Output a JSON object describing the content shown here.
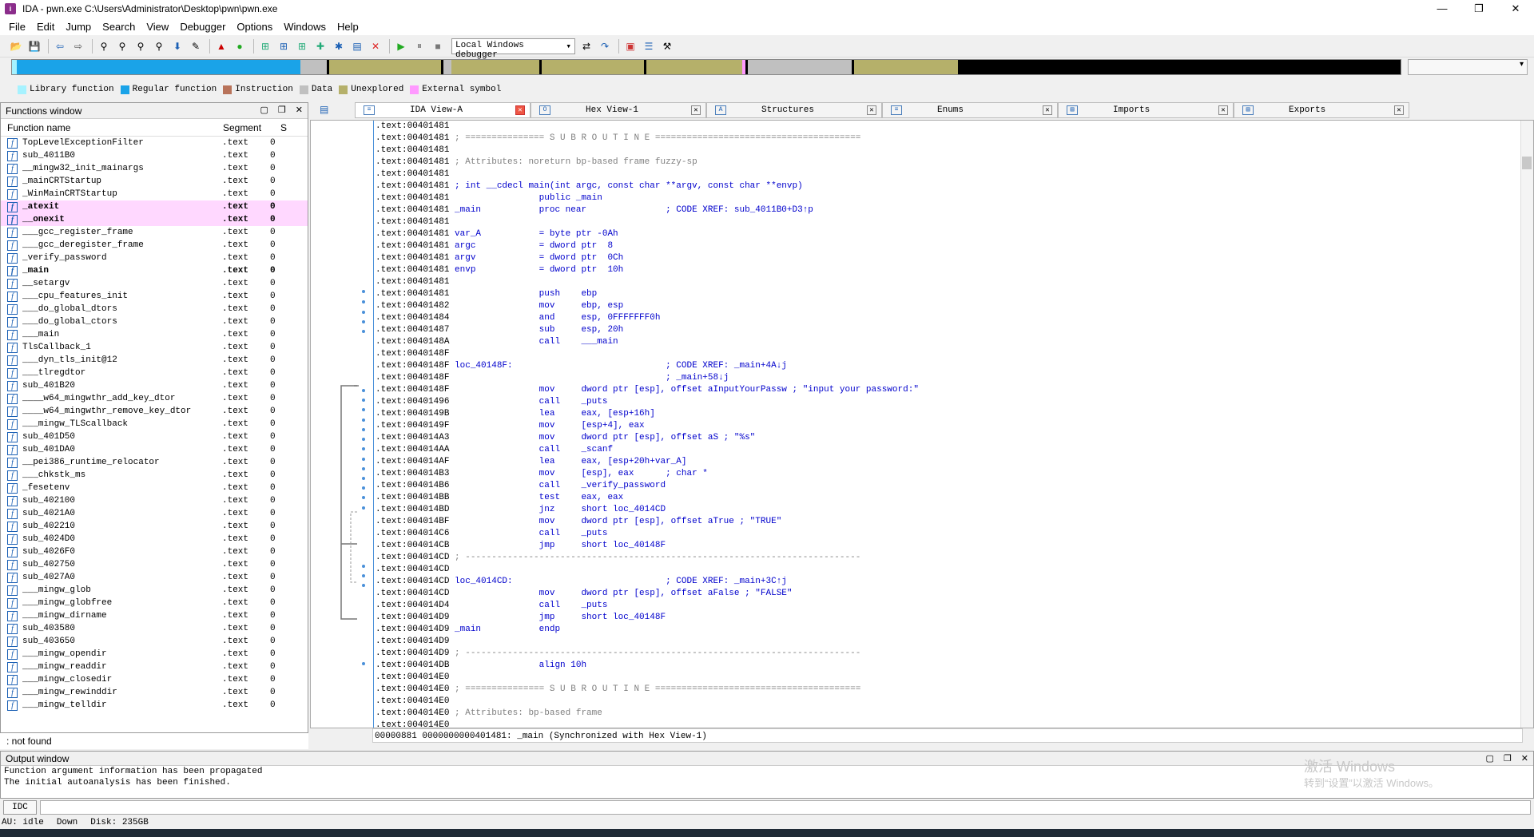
{
  "window": {
    "title": "IDA - pwn.exe C:\\Users\\Administrator\\Desktop\\pwn\\pwn.exe",
    "min": "—",
    "max": "❐",
    "close": "✕"
  },
  "menu": [
    "File",
    "Edit",
    "Jump",
    "Search",
    "View",
    "Debugger",
    "Options",
    "Windows",
    "Help"
  ],
  "toolbar": {
    "debugger": "Local Windows debugger"
  },
  "legend": [
    {
      "label": "Library function",
      "color": "#a6f2ff"
    },
    {
      "label": "Regular function",
      "color": "#1aa3e8"
    },
    {
      "label": "Instruction",
      "color": "#b8735a"
    },
    {
      "label": "Data",
      "color": "#c0c0c0"
    },
    {
      "label": "Unexplored",
      "color": "#b5b06a"
    },
    {
      "label": "External symbol",
      "color": "#ff99ff"
    }
  ],
  "functions_window": {
    "title": "Functions window",
    "col_name": "Function name",
    "col_segment": "Segment",
    "col_extra": "S",
    "rows": [
      {
        "name": "TopLevelExceptionFilter",
        "seg": ".text",
        "x": "0"
      },
      {
        "name": "sub_4011B0",
        "seg": ".text",
        "x": "0"
      },
      {
        "name": "__mingw32_init_mainargs",
        "seg": ".text",
        "x": "0"
      },
      {
        "name": "_mainCRTStartup",
        "seg": ".text",
        "x": "0"
      },
      {
        "name": "_WinMainCRTStartup",
        "seg": ".text",
        "x": "0"
      },
      {
        "name": "_atexit",
        "seg": ".text",
        "x": "0",
        "style": "pink"
      },
      {
        "name": "__onexit",
        "seg": ".text",
        "x": "0",
        "style": "pink"
      },
      {
        "name": "___gcc_register_frame",
        "seg": ".text",
        "x": "0"
      },
      {
        "name": "___gcc_deregister_frame",
        "seg": ".text",
        "x": "0"
      },
      {
        "name": "_verify_password",
        "seg": ".text",
        "x": "0"
      },
      {
        "name": "_main",
        "seg": ".text",
        "x": "0",
        "style": "bold"
      },
      {
        "name": "__setargv",
        "seg": ".text",
        "x": "0"
      },
      {
        "name": "___cpu_features_init",
        "seg": ".text",
        "x": "0"
      },
      {
        "name": "___do_global_dtors",
        "seg": ".text",
        "x": "0"
      },
      {
        "name": "___do_global_ctors",
        "seg": ".text",
        "x": "0"
      },
      {
        "name": "___main",
        "seg": ".text",
        "x": "0"
      },
      {
        "name": "TlsCallback_1",
        "seg": ".text",
        "x": "0"
      },
      {
        "name": "___dyn_tls_init@12",
        "seg": ".text",
        "x": "0"
      },
      {
        "name": "___tlregdtor",
        "seg": ".text",
        "x": "0"
      },
      {
        "name": "sub_401B20",
        "seg": ".text",
        "x": "0"
      },
      {
        "name": "____w64_mingwthr_add_key_dtor",
        "seg": ".text",
        "x": "0"
      },
      {
        "name": "____w64_mingwthr_remove_key_dtor",
        "seg": ".text",
        "x": "0"
      },
      {
        "name": "___mingw_TLScallback",
        "seg": ".text",
        "x": "0"
      },
      {
        "name": "sub_401D50",
        "seg": ".text",
        "x": "0"
      },
      {
        "name": "sub_401DA0",
        "seg": ".text",
        "x": "0"
      },
      {
        "name": "__pei386_runtime_relocator",
        "seg": ".text",
        "x": "0"
      },
      {
        "name": "___chkstk_ms",
        "seg": ".text",
        "x": "0"
      },
      {
        "name": "_fesetenv",
        "seg": ".text",
        "x": "0"
      },
      {
        "name": "sub_402100",
        "seg": ".text",
        "x": "0"
      },
      {
        "name": "sub_4021A0",
        "seg": ".text",
        "x": "0"
      },
      {
        "name": "sub_402210",
        "seg": ".text",
        "x": "0"
      },
      {
        "name": "sub_4024D0",
        "seg": ".text",
        "x": "0"
      },
      {
        "name": "sub_4026F0",
        "seg": ".text",
        "x": "0"
      },
      {
        "name": "sub_402750",
        "seg": ".text",
        "x": "0"
      },
      {
        "name": "sub_4027A0",
        "seg": ".text",
        "x": "0"
      },
      {
        "name": "___mingw_glob",
        "seg": ".text",
        "x": "0"
      },
      {
        "name": "___mingw_globfree",
        "seg": ".text",
        "x": "0"
      },
      {
        "name": "___mingw_dirname",
        "seg": ".text",
        "x": "0"
      },
      {
        "name": "sub_403580",
        "seg": ".text",
        "x": "0"
      },
      {
        "name": "sub_403650",
        "seg": ".text",
        "x": "0"
      },
      {
        "name": "___mingw_opendir",
        "seg": ".text",
        "x": "0"
      },
      {
        "name": "___mingw_readdir",
        "seg": ".text",
        "x": "0"
      },
      {
        "name": "___mingw_closedir",
        "seg": ".text",
        "x": "0"
      },
      {
        "name": "___mingw_rewinddir",
        "seg": ".text",
        "x": "0"
      },
      {
        "name": "___mingw_telldir",
        "seg": ".text",
        "x": "0"
      }
    ],
    "status": ": not found"
  },
  "tabs": [
    {
      "label": "IDA View-A",
      "active": true
    },
    {
      "label": "Hex View-1"
    },
    {
      "label": "Structures"
    },
    {
      "label": "Enums"
    },
    {
      "label": "Imports"
    },
    {
      "label": "Exports"
    }
  ],
  "code_lines": [
    {
      "a": ".text:00401481",
      "t": ""
    },
    {
      "a": ".text:00401481",
      "t": " ; =============== S U B R O U T I N E =======================================",
      "c": "cm"
    },
    {
      "a": ".text:00401481",
      "t": ""
    },
    {
      "a": ".text:00401481",
      "t": " ; Attributes: noreturn bp-based frame fuzzy-sp",
      "c": "cm"
    },
    {
      "a": ".text:00401481",
      "t": ""
    },
    {
      "a": ".text:00401481",
      "t": " ; int __cdecl main(int argc, const char **argv, const char **envp)",
      "c": "blue"
    },
    {
      "a": ".text:00401481",
      "t": "                 public _main",
      "c": "blue"
    },
    {
      "a": ".text:00401481",
      "t": " _main           proc near               ; CODE XREF: sub_4011B0+D3↑p",
      "c": "blue"
    },
    {
      "a": ".text:00401481",
      "t": ""
    },
    {
      "a": ".text:00401481",
      "t": " var_A           = byte ptr -0Ah",
      "c": "blue"
    },
    {
      "a": ".text:00401481",
      "t": " argc            = dword ptr  8",
      "c": "blue"
    },
    {
      "a": ".text:00401481",
      "t": " argv            = dword ptr  0Ch",
      "c": "blue"
    },
    {
      "a": ".text:00401481",
      "t": " envp            = dword ptr  10h",
      "c": "blue"
    },
    {
      "a": ".text:00401481",
      "t": "",
      "c": "blue"
    },
    {
      "a": ".text:00401481",
      "t": "                 push    ebp",
      "c": "blue"
    },
    {
      "a": ".text:00401482",
      "t": "                 mov     ebp, esp",
      "c": "blue"
    },
    {
      "a": ".text:00401484",
      "t": "                 and     esp, 0FFFFFFF0h",
      "c": "blue"
    },
    {
      "a": ".text:00401487",
      "t": "                 sub     esp, 20h",
      "c": "blue"
    },
    {
      "a": ".text:0040148A",
      "t": "                 call    ___main",
      "c": "blue"
    },
    {
      "a": ".text:0040148F",
      "t": ""
    },
    {
      "a": ".text:0040148F",
      "t": " loc_40148F:                             ; CODE XREF: _main+4A↓j",
      "c": "blue"
    },
    {
      "a": ".text:0040148F",
      "t": "                                         ; _main+58↓j",
      "c": "blue"
    },
    {
      "a": ".text:0040148F",
      "t": "                 mov     dword ptr [esp], offset aInputYourPassw ; \"input your password:\"",
      "c": "blue"
    },
    {
      "a": ".text:00401496",
      "t": "                 call    _puts",
      "c": "blue"
    },
    {
      "a": ".text:0040149B",
      "t": "                 lea     eax, [esp+16h]",
      "c": "blue"
    },
    {
      "a": ".text:0040149F",
      "t": "                 mov     [esp+4], eax",
      "c": "blue"
    },
    {
      "a": ".text:004014A3",
      "t": "                 mov     dword ptr [esp], offset aS ; \"%s\"",
      "c": "blue"
    },
    {
      "a": ".text:004014AA",
      "t": "                 call    _scanf",
      "c": "blue"
    },
    {
      "a": ".text:004014AF",
      "t": "                 lea     eax, [esp+20h+var_A]",
      "c": "blue"
    },
    {
      "a": ".text:004014B3",
      "t": "                 mov     [esp], eax      ; char *",
      "c": "blue"
    },
    {
      "a": ".text:004014B6",
      "t": "                 call    _verify_password",
      "c": "blue"
    },
    {
      "a": ".text:004014BB",
      "t": "                 test    eax, eax",
      "c": "blue"
    },
    {
      "a": ".text:004014BD",
      "t": "                 jnz     short loc_4014CD",
      "c": "blue"
    },
    {
      "a": ".text:004014BF",
      "t": "                 mov     dword ptr [esp], offset aTrue ; \"TRUE\"",
      "c": "blue"
    },
    {
      "a": ".text:004014C6",
      "t": "                 call    _puts",
      "c": "blue"
    },
    {
      "a": ".text:004014CB",
      "t": "                 jmp     short loc_40148F",
      "c": "blue"
    },
    {
      "a": ".text:004014CD",
      "t": " ; ---------------------------------------------------------------------------",
      "c": "cm"
    },
    {
      "a": ".text:004014CD",
      "t": ""
    },
    {
      "a": ".text:004014CD",
      "t": " loc_4014CD:                             ; CODE XREF: _main+3C↑j",
      "c": "blue"
    },
    {
      "a": ".text:004014CD",
      "t": "                 mov     dword ptr [esp], offset aFalse ; \"FALSE\"",
      "c": "blue"
    },
    {
      "a": ".text:004014D4",
      "t": "                 call    _puts",
      "c": "blue"
    },
    {
      "a": ".text:004014D9",
      "t": "                 jmp     short loc_40148F",
      "c": "blue"
    },
    {
      "a": ".text:004014D9",
      "t": " _main           endp",
      "c": "blue"
    },
    {
      "a": ".text:004014D9",
      "t": ""
    },
    {
      "a": ".text:004014D9",
      "t": " ; ---------------------------------------------------------------------------",
      "c": "cm"
    },
    {
      "a": ".text:004014DB",
      "t": "                 align 10h",
      "c": "blue"
    },
    {
      "a": ".text:004014E0",
      "t": ""
    },
    {
      "a": ".text:004014E0",
      "t": " ; =============== S U B R O U T I N E =======================================",
      "c": "cm"
    },
    {
      "a": ".text:004014E0",
      "t": ""
    },
    {
      "a": ".text:004014E0",
      "t": " ; Attributes: bp-based frame",
      "c": "cm"
    },
    {
      "a": ".text:004014E0",
      "t": ""
    }
  ],
  "view_status": "00000881 0000000000401481: _main (Synchronized with Hex View-1)",
  "output_window": {
    "title": "Output window",
    "lines": [
      "Function argument information has been propagated",
      "The initial autoanalysis has been finished."
    ]
  },
  "idc_label": "IDC",
  "statusbar": {
    "au": "AU:  idle",
    "dir": "Down",
    "disk": "Disk: 235GB"
  },
  "watermark": {
    "line1": "激活 Windows",
    "line2": "转到“设置”以激活 Windows。"
  }
}
